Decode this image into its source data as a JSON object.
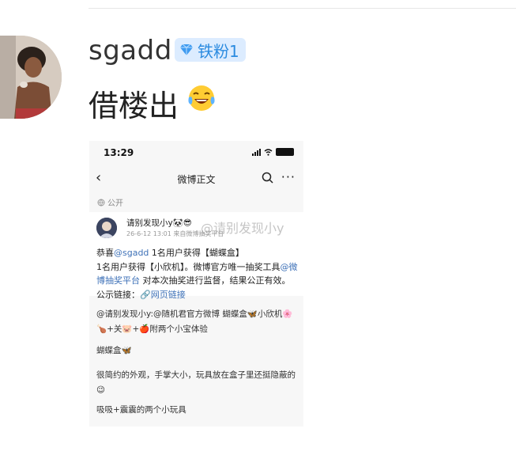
{
  "comment": {
    "username": "sgadd",
    "badge_label": "铁粉1",
    "text": "借楼出",
    "emoji_icon": "laughing-tears-emoji"
  },
  "screenshot": {
    "status_bar": {
      "time": "13:29",
      "battery": "100"
    },
    "nav": {
      "back": "‹",
      "title": "微博正文",
      "more": "···"
    },
    "visibility": "公开",
    "post": {
      "author": "请别发现小y",
      "author_emoji": "🐼😎",
      "time": "26-6-12 13:01 来自微博抽奖平台",
      "body": {
        "part1": "恭喜",
        "mention": "@sgadd",
        "part2": " 1名用户获得【蝴蝶盒】",
        "part3": "1名用户获得【小欣机】。微博官方唯一抽奖工具",
        "platform": "@微博抽奖平台",
        "part4": " 对本次抽奖进行监督，结果公正有效。公示链接：",
        "link": "🔗网页链接"
      }
    },
    "repost": {
      "line1": "@请别发现小y:@随机君官方微博 蝴蝶盒🦋小欣机🌸",
      "line2": "🍗+关🐷+🍎附两个小宝体验",
      "line3": "蝴蝶盒🦋",
      "line4": "很简约的外观，手掌大小，玩具放在盒子里还挺隐蔽的",
      "line5": "😉",
      "line6": "吸吸+震震的两个小玩具"
    },
    "watermark": "@请别发现小y"
  }
}
